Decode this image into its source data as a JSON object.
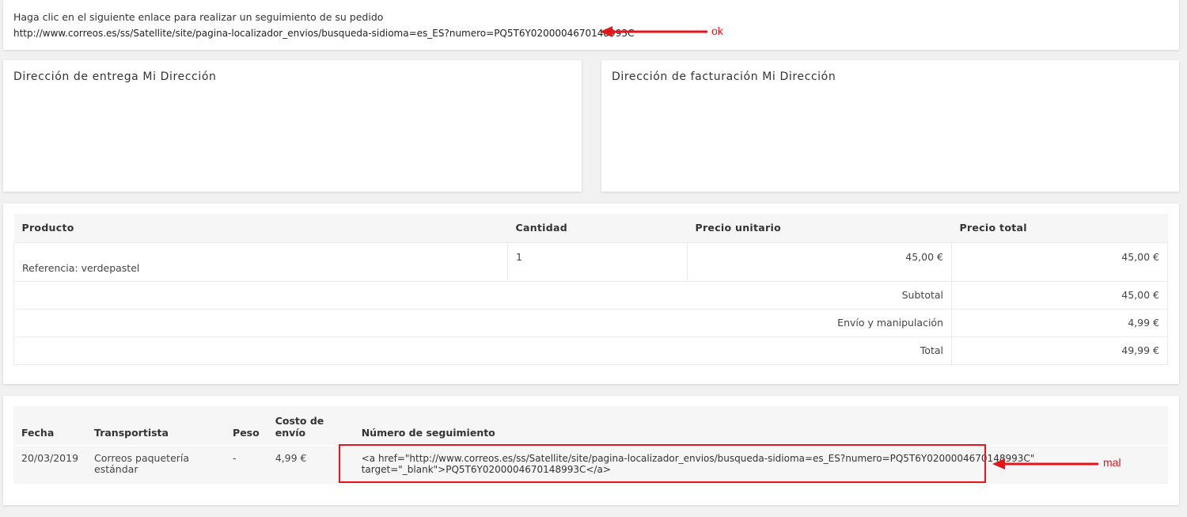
{
  "tracking": {
    "intro": "Haga clic en el siguiente enlace para realizar un seguimiento de su pedido",
    "url": "http://www.correos.es/ss/Satellite/site/pagina-localizador_envios/busqueda-sidioma=es_ES?numero=PQ5T6Y0200004670148993C"
  },
  "addresses": {
    "delivery_title": "Dirección de entrega Mi Dirección",
    "billing_title": "Dirección de facturación Mi Dirección"
  },
  "products": {
    "headers": [
      "Producto",
      "Cantidad",
      "Precio unitario",
      "Precio total"
    ],
    "items": [
      {
        "reference": "Referencia: verdepastel",
        "quantity": "1",
        "unit_price": "45,00 €",
        "total_price": "45,00 €"
      }
    ],
    "summary": [
      {
        "label": "Subtotal",
        "value": "45,00 €"
      },
      {
        "label": "Envío y manipulación",
        "value": "4,99 €"
      },
      {
        "label": "Total",
        "value": "49,99 €"
      }
    ]
  },
  "shipping": {
    "headers": [
      "Fecha",
      "Transportista",
      "Peso",
      "Costo de envío",
      "Número de seguimiento"
    ],
    "rows": [
      {
        "date": "20/03/2019",
        "carrier": "Correos paquetería estándar",
        "weight": "-",
        "cost": "4,99 €",
        "tracking_number": "<a href=\"http://www.correos.es/ss/Satellite/site/pagina-localizador_envios/busqueda-sidioma=es_ES?numero=PQ5T6Y0200004670148993C\" target=\"_blank\">PQ5T6Y0200004670148993C</a>"
      }
    ]
  },
  "annotations": {
    "ok_label": "ok",
    "mal_label": "mal",
    "color": "#e8141a"
  }
}
